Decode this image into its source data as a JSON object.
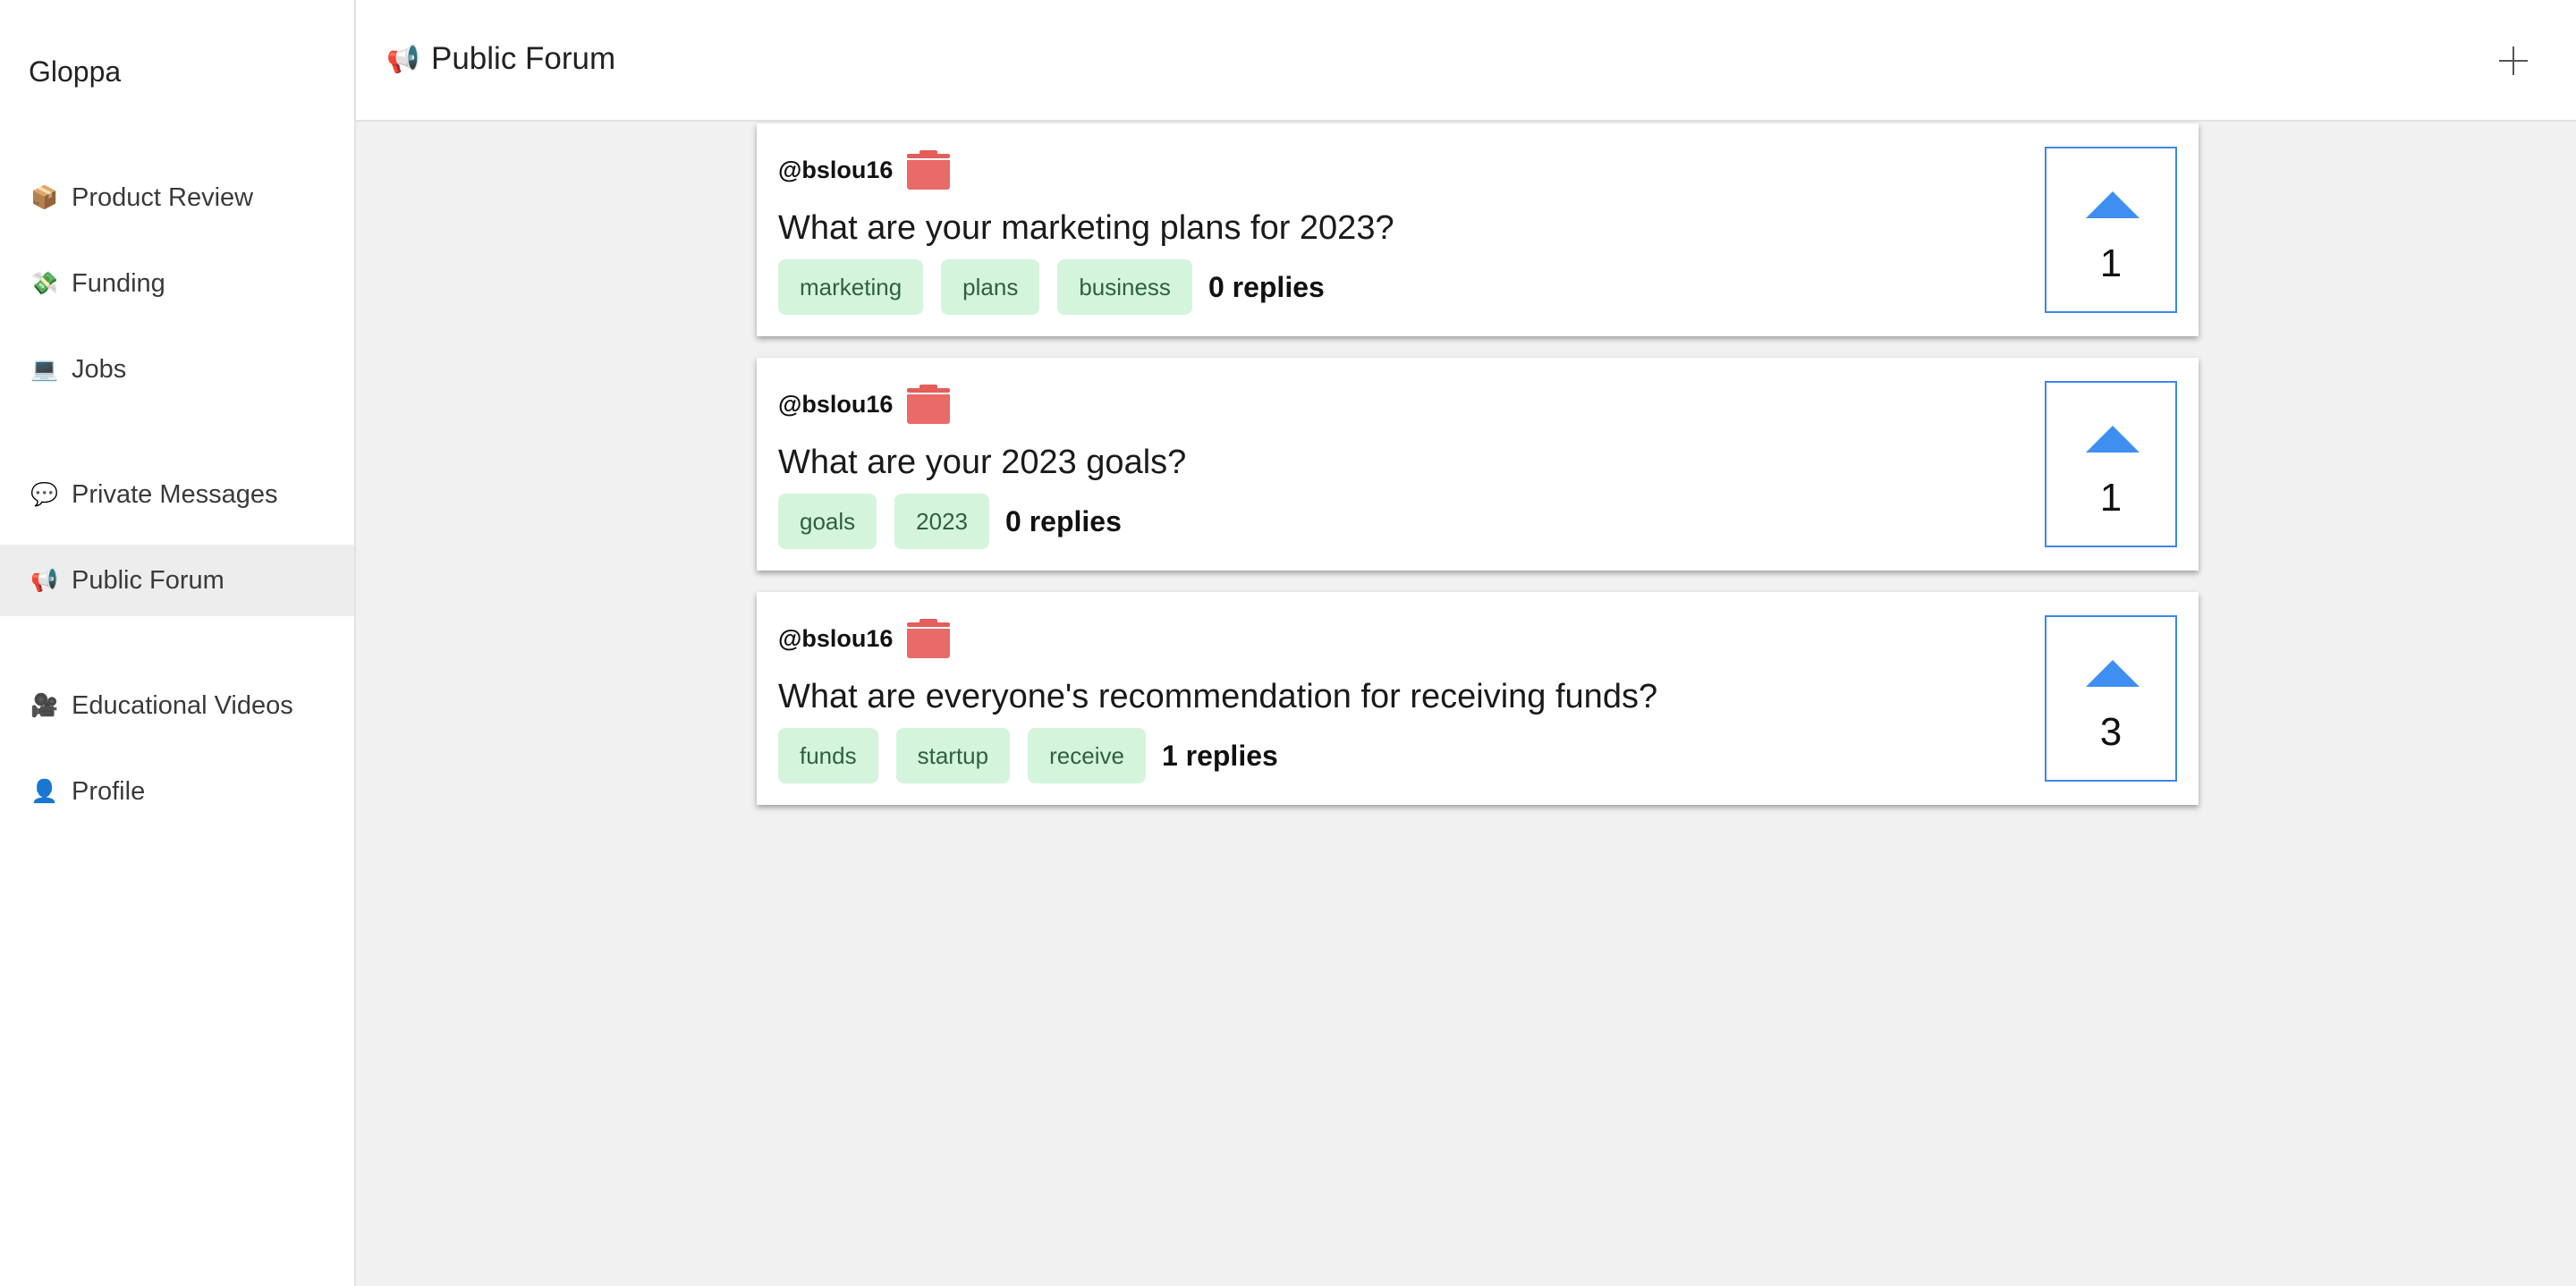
{
  "app": {
    "brand": "Gloppa"
  },
  "sidebar": {
    "items": [
      {
        "icon": "📦",
        "icon_name": "package-icon",
        "label": "Product Review"
      },
      {
        "icon": "💸",
        "icon_name": "money-wings-icon",
        "label": "Funding"
      },
      {
        "icon": "💻",
        "icon_name": "laptop-icon",
        "label": "Jobs"
      },
      {
        "icon": "💬",
        "icon_name": "speech-bubble-icon",
        "label": "Private Messages"
      },
      {
        "icon": "📢",
        "icon_name": "megaphone-icon",
        "label": "Public Forum",
        "active": true
      },
      {
        "icon": "🎥",
        "icon_name": "video-camera-icon",
        "label": "Educational Videos"
      },
      {
        "icon": "👤",
        "icon_name": "user-icon",
        "label": "Profile"
      }
    ]
  },
  "header": {
    "icon": "📢",
    "icon_name": "megaphone-icon",
    "title": "Public Forum",
    "add_icon": "plus-icon"
  },
  "colors": {
    "accent": "#3f86e8",
    "tag_bg": "#d4f4dc",
    "tag_text": "#2e6040",
    "trash": "#e96a66",
    "active_nav_bg": "#ededed"
  },
  "posts": [
    {
      "author": "@bslou16",
      "question": "What are your marketing plans for 2023?",
      "tags": [
        "marketing",
        "plans",
        "business"
      ],
      "replies": "0 replies",
      "votes": "1"
    },
    {
      "author": "@bslou16",
      "question": "What are your 2023 goals?",
      "tags": [
        "goals",
        "2023"
      ],
      "replies": "0 replies",
      "votes": "1"
    },
    {
      "author": "@bslou16",
      "question": "What are everyone's recommendation for receiving funds?",
      "tags": [
        "funds",
        "startup",
        "receive"
      ],
      "replies": "1 replies",
      "votes": "3"
    }
  ]
}
